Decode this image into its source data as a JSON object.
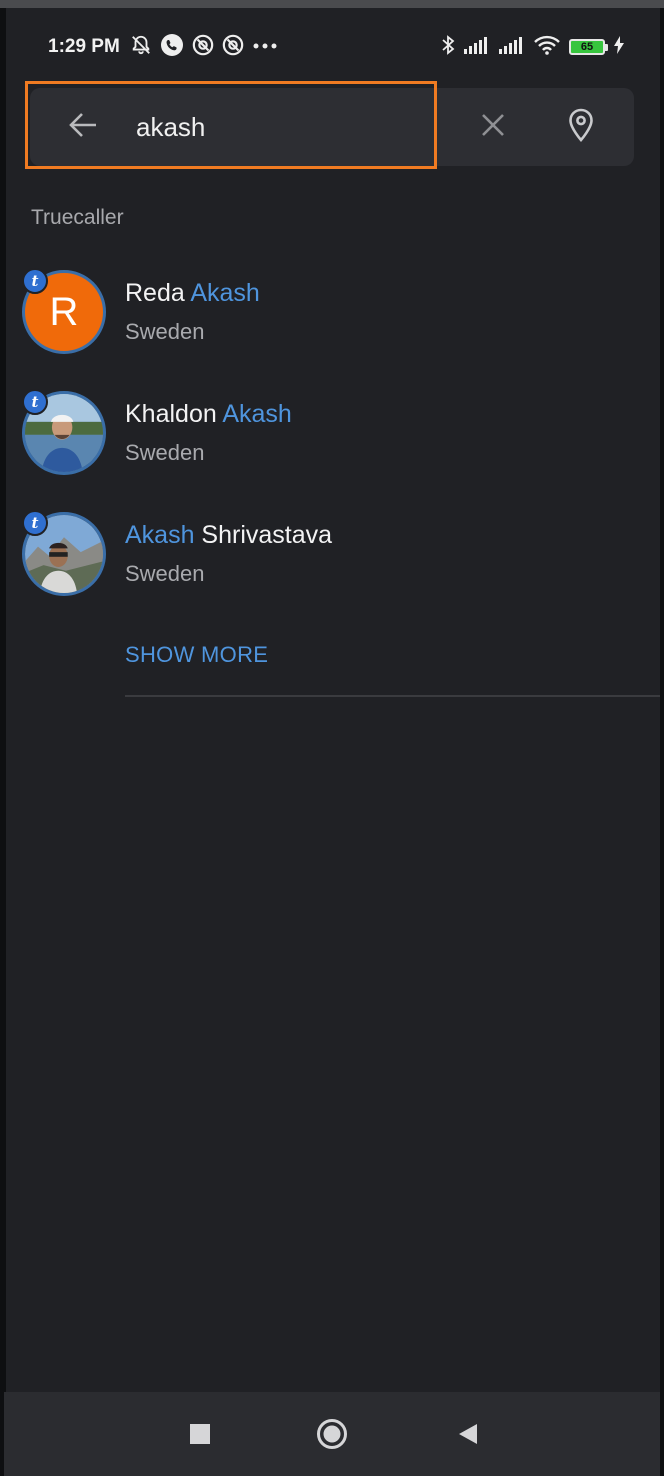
{
  "status_bar": {
    "time": "1:29 PM",
    "left_icons": [
      "bell-off-icon",
      "whatsapp-call-icon",
      "at-sign-icon",
      "at-sign-icon",
      "more-dots-icon"
    ],
    "right_icons": [
      "bluetooth-icon",
      "signal-icon",
      "signal-icon",
      "wifi-icon",
      "battery-icon",
      "charging-icon"
    ],
    "battery_level": "65"
  },
  "search": {
    "value": "akash",
    "back_icon": "arrow-left-icon",
    "clear_icon": "close-icon",
    "location_icon": "location-pin-icon"
  },
  "section": {
    "title": "Truecaller"
  },
  "results": [
    {
      "name_prefix": "Reda ",
      "name_match": "Akash",
      "name_suffix": "",
      "location": "Sweden",
      "avatar_letter": "R",
      "avatar_type": "letter"
    },
    {
      "name_prefix": "Khaldon ",
      "name_match": "Akash",
      "name_suffix": "",
      "location": "Sweden",
      "avatar_type": "photo"
    },
    {
      "name_prefix": "",
      "name_match": "Akash",
      "name_suffix": " Shrivastava",
      "location": "Sweden",
      "avatar_type": "photo"
    }
  ],
  "badge_letter": "t",
  "show_more": "SHOW MORE",
  "nav": {
    "icons": [
      "recents-square-icon",
      "home-circle-icon",
      "back-triangle-icon"
    ]
  },
  "colors": {
    "accent": "#4f95de",
    "highlight_border": "#f07b22",
    "avatar_orange": "#f06a0a",
    "background": "#202125"
  }
}
